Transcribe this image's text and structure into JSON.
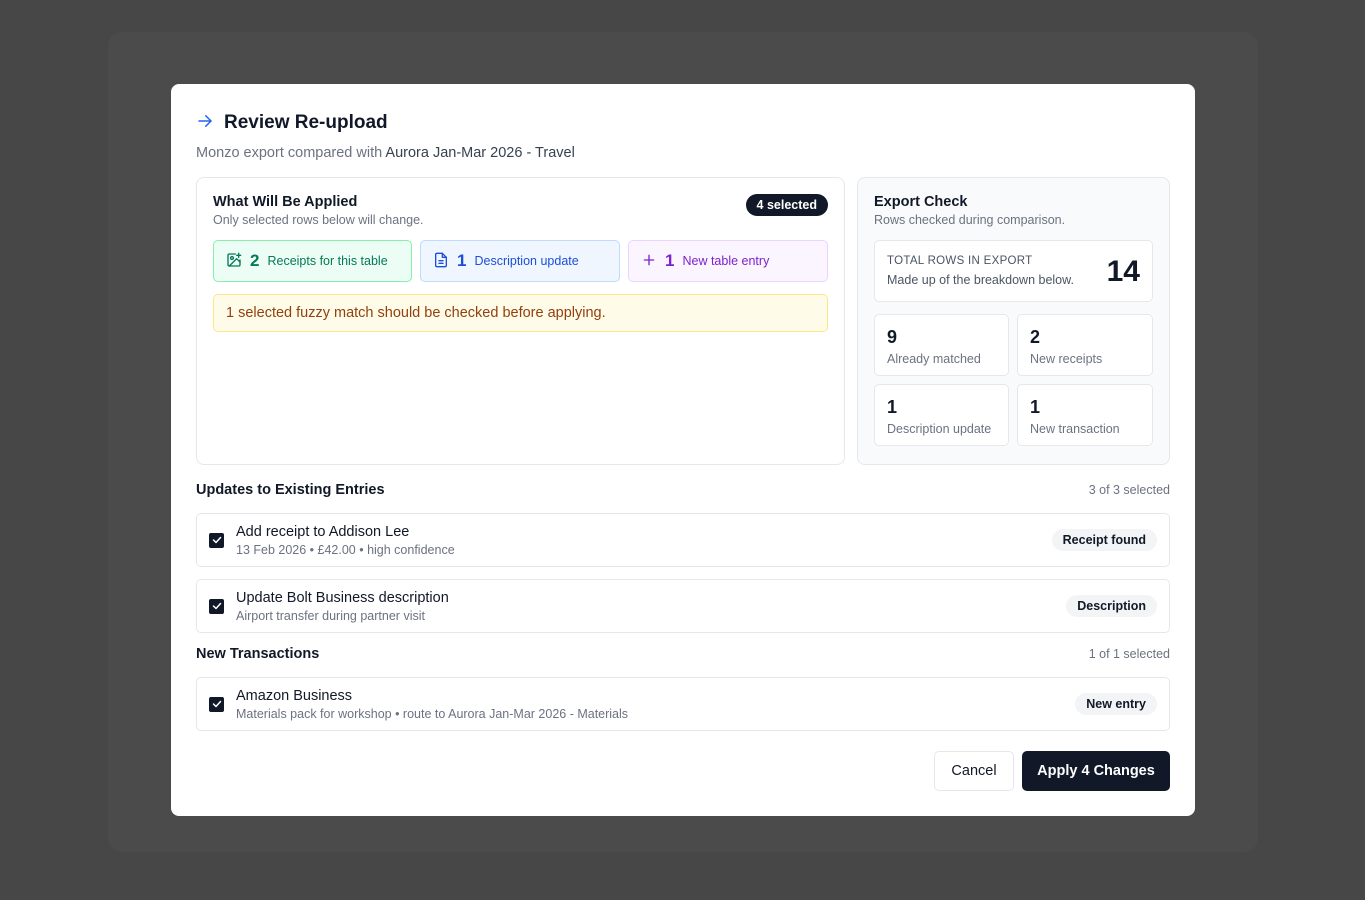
{
  "dialog": {
    "title": "Review Re-upload",
    "subtitle_prefix": "Monzo export compared with ",
    "subtitle_target": "Aurora Jan-Mar 2026 - Travel"
  },
  "applied": {
    "title": "What Will Be Applied",
    "subtitle": "Only selected rows below will change.",
    "selected_badge": "4 selected",
    "chips": [
      {
        "icon": "image-plus-icon",
        "count": "2",
        "label": "Receipts for this table"
      },
      {
        "icon": "document-icon",
        "count": "1",
        "label": "Description update"
      },
      {
        "icon": "plus-icon",
        "count": "1",
        "label": "New table entry"
      }
    ],
    "warning": "1 selected fuzzy match should be checked before applying."
  },
  "export_check": {
    "title": "Export Check",
    "subtitle": "Rows checked during comparison.",
    "total_label": "TOTAL ROWS IN EXPORT",
    "total_sub": "Made up of the breakdown below.",
    "total_value": "14",
    "stats": [
      {
        "value": "9",
        "label": "Already matched"
      },
      {
        "value": "2",
        "label": "New receipts"
      },
      {
        "value": "1",
        "label": "Description update"
      },
      {
        "value": "1",
        "label": "New transaction"
      }
    ]
  },
  "updates": {
    "title": "Updates to Existing Entries",
    "count": "3 of 3 selected",
    "rows": [
      {
        "title": "Add receipt to Addison Lee",
        "sub": "13 Feb 2026 • £42.00 • high confidence",
        "tag": "Receipt found"
      },
      {
        "title": "Update Bolt Business description",
        "sub": "Airport transfer during partner visit",
        "tag": "Description"
      }
    ]
  },
  "new_transactions": {
    "title": "New Transactions",
    "count": "1 of 1 selected",
    "rows": [
      {
        "title": "Amazon Business",
        "sub": "Materials pack for workshop • route to Aurora Jan-Mar 2026 - Materials",
        "tag": "New entry"
      }
    ]
  },
  "footer": {
    "cancel_label": "Cancel",
    "apply_label": "Apply 4 Changes"
  },
  "colors": {
    "accent_blue": "#2563eb",
    "primary_dark": "#111827",
    "success_green": "#047857",
    "info_blue": "#1d4ed8",
    "purple": "#7e22ce",
    "warning_text": "#92400e"
  }
}
